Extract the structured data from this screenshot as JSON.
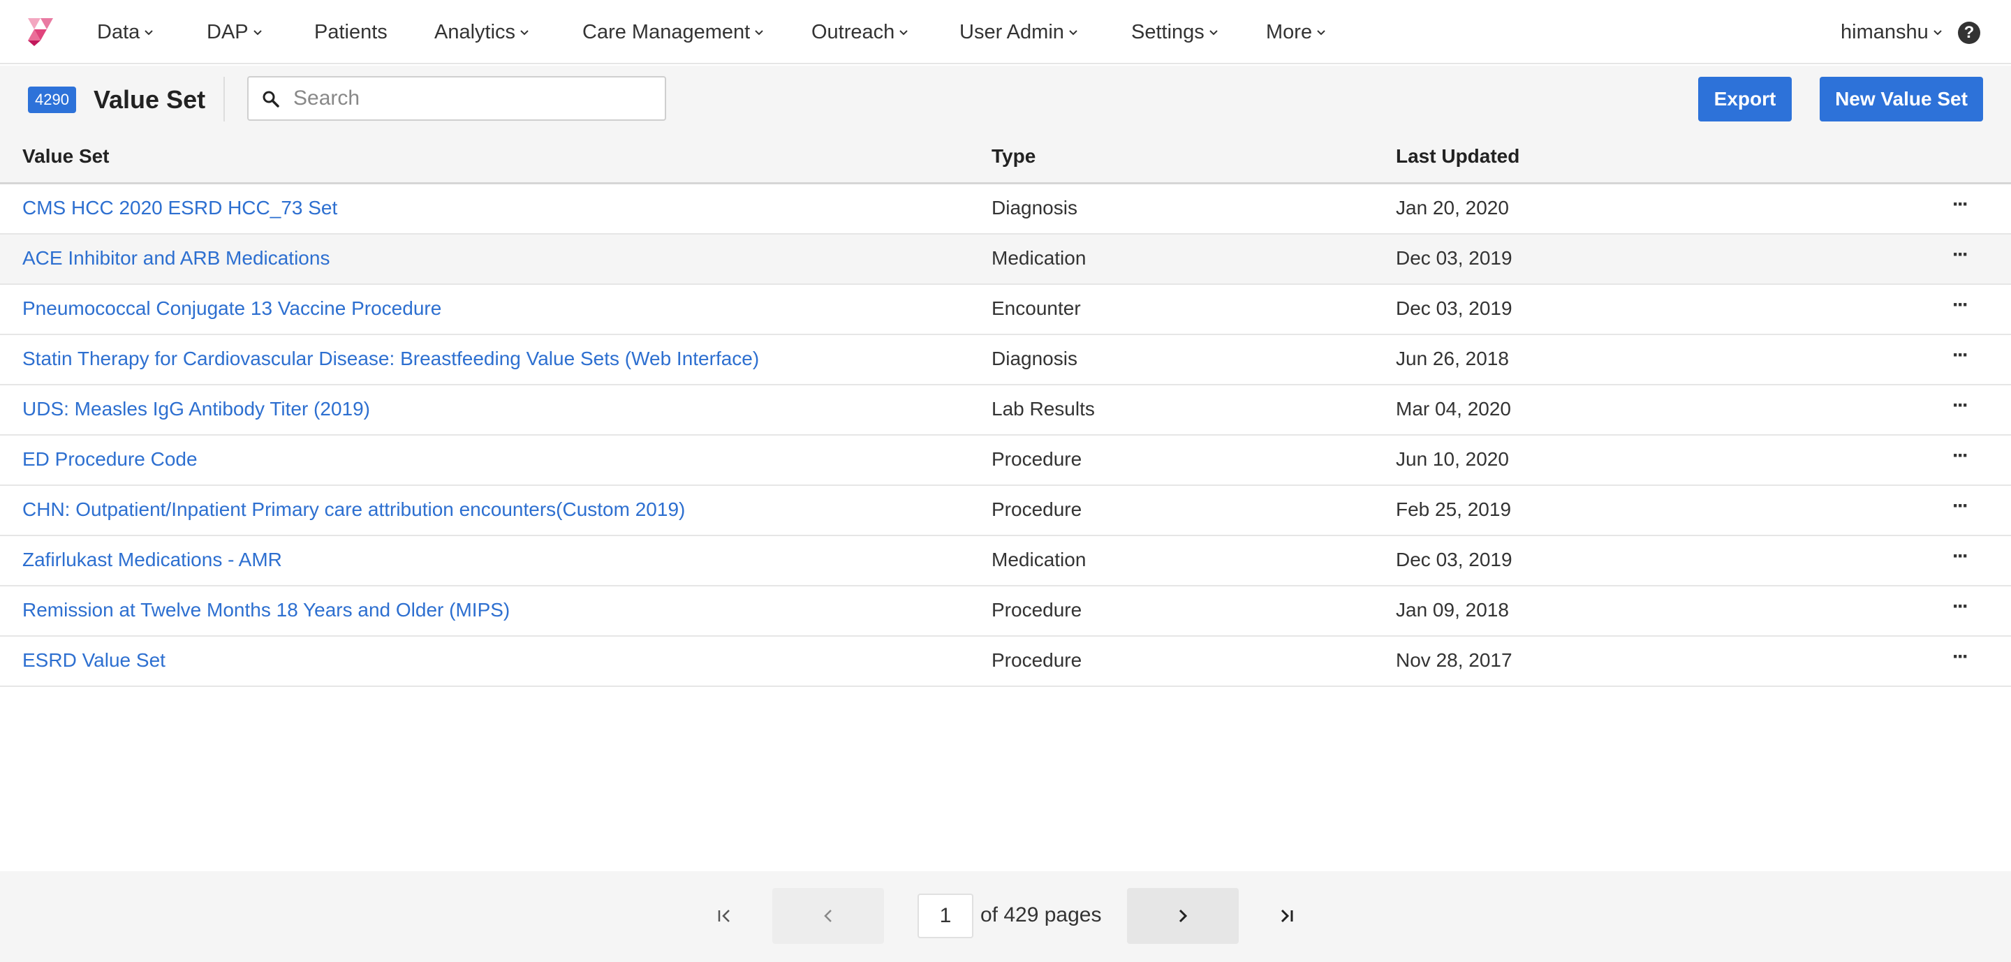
{
  "nav": {
    "items": [
      {
        "label": "Data",
        "chevron": true
      },
      {
        "label": "DAP",
        "chevron": true
      },
      {
        "label": "Patients",
        "chevron": false
      },
      {
        "label": "Analytics",
        "chevron": true
      },
      {
        "label": "Care Management",
        "chevron": true
      },
      {
        "label": "Outreach",
        "chevron": true
      },
      {
        "label": "User Admin",
        "chevron": true
      },
      {
        "label": "Settings",
        "chevron": true
      },
      {
        "label": "More",
        "chevron": true
      }
    ],
    "user": "himanshu",
    "help": "?"
  },
  "toolbar": {
    "count": "4290",
    "title": "Value Set",
    "search_placeholder": "Search",
    "export_label": "Export",
    "new_label": "New Value Set"
  },
  "table": {
    "headers": [
      "Value Set",
      "Type",
      "Last Updated"
    ],
    "rows": [
      {
        "name": "CMS HCC 2020 ESRD HCC_73 Set",
        "type": "Diagnosis",
        "updated": "Jan 20, 2020"
      },
      {
        "name": "ACE Inhibitor and ARB Medications",
        "type": "Medication",
        "updated": "Dec 03, 2019"
      },
      {
        "name": "Pneumococcal Conjugate 13 Vaccine Procedure",
        "type": "Encounter",
        "updated": "Dec 03, 2019"
      },
      {
        "name": "Statin Therapy for Cardiovascular Disease: Breastfeeding Value Sets (Web Interface)",
        "type": "Diagnosis",
        "updated": "Jun 26, 2018"
      },
      {
        "name": "UDS: Measles IgG Antibody Titer (2019)",
        "type": "Lab Results",
        "updated": "Mar 04, 2020"
      },
      {
        "name": "ED Procedure Code",
        "type": "Procedure",
        "updated": "Jun 10, 2020"
      },
      {
        "name": "CHN: Outpatient/Inpatient Primary care attribution encounters(Custom 2019)",
        "type": "Procedure",
        "updated": "Feb 25, 2019"
      },
      {
        "name": "Zafirlukast Medications - AMR",
        "type": "Medication",
        "updated": "Dec 03, 2019"
      },
      {
        "name": "Remission at Twelve Months 18 Years and Older (MIPS)",
        "type": "Procedure",
        "updated": "Jan 09, 2018"
      },
      {
        "name": "ESRD Value Set",
        "type": "Procedure",
        "updated": "Nov 28, 2017"
      }
    ],
    "row_menu": "···"
  },
  "pagination": {
    "current_page": "1",
    "of_text": "of 429 pages"
  },
  "colors": {
    "accent": "#2d72d9",
    "link": "#2d6fd0",
    "header_bg": "#f5f5f5"
  }
}
